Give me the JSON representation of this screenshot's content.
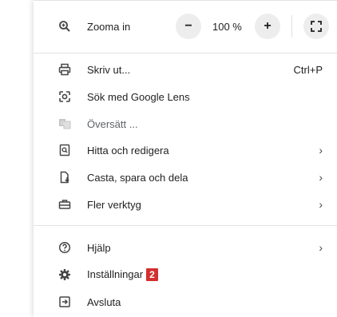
{
  "zoom": {
    "label": "Zooma in",
    "minus": "−",
    "value": "100 %",
    "plus": "+"
  },
  "items": [
    {
      "label": "Skriv ut...",
      "shortcut": "Ctrl+P"
    },
    {
      "label": "Sök med Google Lens"
    },
    {
      "label": "Översätt ..."
    },
    {
      "label": "Hitta och redigera",
      "chevron": "›"
    },
    {
      "label": "Casta, spara och dela",
      "chevron": "›"
    },
    {
      "label": "Fler verktyg",
      "chevron": "›"
    }
  ],
  "help": {
    "label": "Hjälp",
    "chevron": "›"
  },
  "settings": {
    "label": "Inställningar",
    "badge": "2"
  },
  "exit": {
    "label": "Avsluta"
  },
  "colors": {
    "badge": "#d32f2f",
    "divider": "#e3e3e3"
  }
}
